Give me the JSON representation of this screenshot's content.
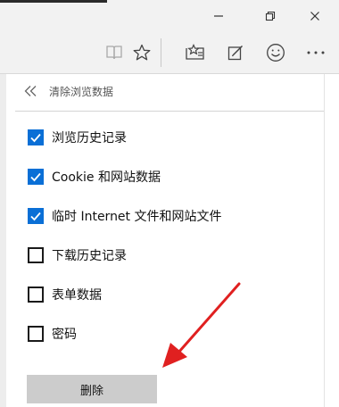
{
  "panel": {
    "title": "清除浏览数据",
    "options": [
      {
        "label": "浏览历史记录",
        "checked": true
      },
      {
        "label": "Cookie 和网站数据",
        "checked": true
      },
      {
        "label": "临时 Internet 文件和网站文件",
        "checked": true
      },
      {
        "label": "下载历史记录",
        "checked": false
      },
      {
        "label": "表单数据",
        "checked": false
      },
      {
        "label": "密码",
        "checked": false
      }
    ],
    "delete_label": "删除"
  },
  "colors": {
    "accent": "#0a6fd6",
    "arrow": "#e02020",
    "button_bg": "#cccccc",
    "toolbar_bg": "#f2f2f2"
  },
  "icons": {
    "window": [
      "minimize-icon",
      "restore-icon",
      "close-icon"
    ],
    "toolbar": [
      "reading-view-icon",
      "favorite-star-icon",
      "hub-icon",
      "web-note-icon",
      "feedback-smiley-icon",
      "more-icon"
    ]
  }
}
